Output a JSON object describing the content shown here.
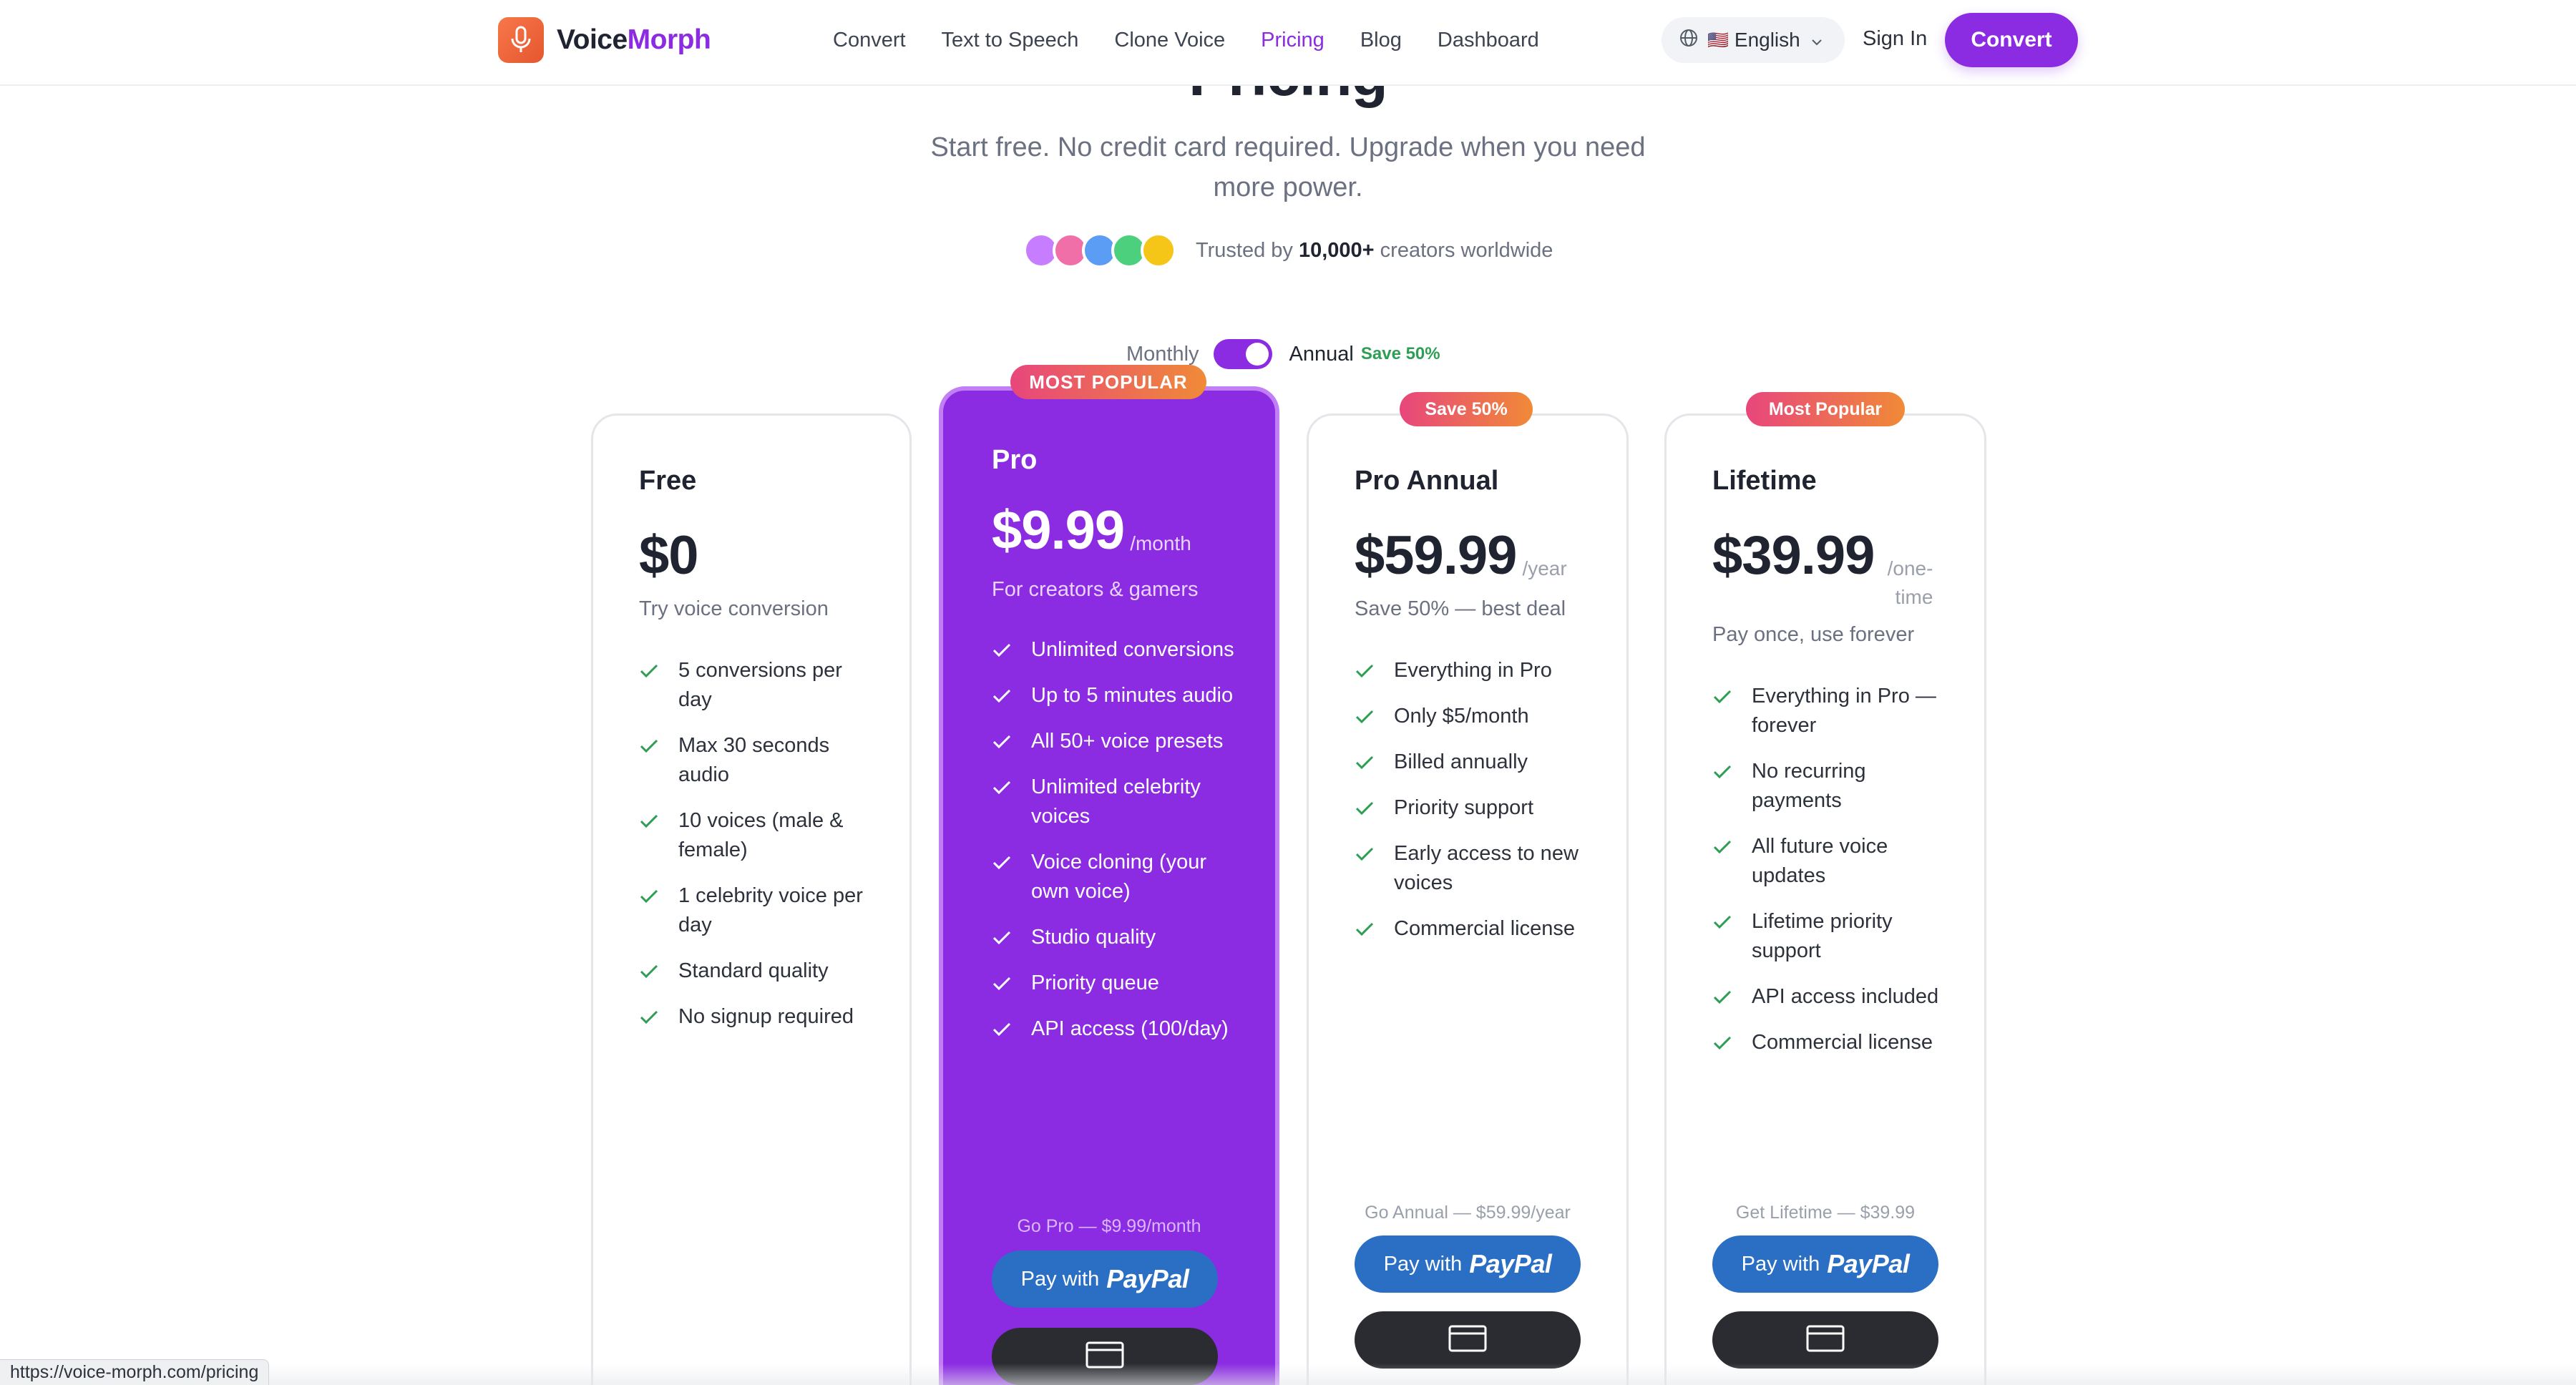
{
  "header": {
    "logo_text_a": "Voice",
    "logo_text_b": "Morph",
    "nav": [
      {
        "label": "Convert",
        "active": false
      },
      {
        "label": "Text to Speech",
        "active": false
      },
      {
        "label": "Clone Voice",
        "active": false
      },
      {
        "label": "Pricing",
        "active": true
      },
      {
        "label": "Blog",
        "active": false
      },
      {
        "label": "Dashboard",
        "active": false
      }
    ],
    "language": {
      "flag": "🇺🇸",
      "label": "English"
    },
    "sign_in": "Sign In",
    "convert": "Convert"
  },
  "hero": {
    "title": "Pricing",
    "subtitle": "Start free. No credit card required. Upgrade when you need more power.",
    "trust_prefix": "Trusted by ",
    "trust_count": "10,000+",
    "trust_suffix": " creators worldwide",
    "avatar_colors": [
      "#c77dff",
      "#f06fa8",
      "#5b9cf5",
      "#4cd07d",
      "#f5c518"
    ]
  },
  "billing": {
    "monthly_label": "Monthly",
    "annual_label": "Annual",
    "save_label": "Save 50%",
    "annual_selected": true
  },
  "plans": [
    {
      "name": "Free",
      "price": "$0",
      "period": "",
      "description": "Try voice conversion",
      "badge": "",
      "features": [
        "5 conversions per day",
        "Max 30 seconds audio",
        "10 voices (male & female)",
        "1 celebrity voice per day",
        "Standard quality",
        "No signup required"
      ]
    },
    {
      "name": "Pro",
      "price": "$9.99",
      "period": "/month",
      "description": "For creators & gamers",
      "badge": "MOST POPULAR",
      "features": [
        "Unlimited conversions",
        "Up to 5 minutes audio",
        "All 50+ voice presets",
        "Unlimited celebrity voices",
        "Voice cloning (your own voice)",
        "Studio quality",
        "Priority queue",
        "API access (100/day)"
      ],
      "cta_note": "Go Pro — $9.99/month",
      "paypal_prefix": "Pay with",
      "paypal_brand": "PayPal"
    },
    {
      "name": "Pro Annual",
      "price": "$59.99",
      "period": "/year",
      "description": "Save 50% — best deal",
      "badge": "Save 50%",
      "features": [
        "Everything in Pro",
        "Only $5/month",
        "Billed annually",
        "Priority support",
        "Early access to new voices",
        "Commercial license"
      ],
      "cta_note": "Go Annual — $59.99/year",
      "paypal_prefix": "Pay with",
      "paypal_brand": "PayPal"
    },
    {
      "name": "Lifetime",
      "price": "$39.99",
      "period": "/one-time",
      "description": "Pay once, use forever",
      "badge": "Most Popular",
      "features": [
        "Everything in Pro — forever",
        "No recurring payments",
        "All future voice updates",
        "Lifetime priority support",
        "API access included",
        "Commercial license"
      ],
      "cta_note": "Get Lifetime — $39.99",
      "paypal_prefix": "Pay with",
      "paypal_brand": "PayPal"
    }
  ],
  "status_bar": {
    "url": "https://voice-morph.com/pricing"
  },
  "colors": {
    "accent": "#8b2be2",
    "paypal": "#2a6fc4",
    "check": "#2f9e55",
    "logo": "#ef6a3c"
  }
}
